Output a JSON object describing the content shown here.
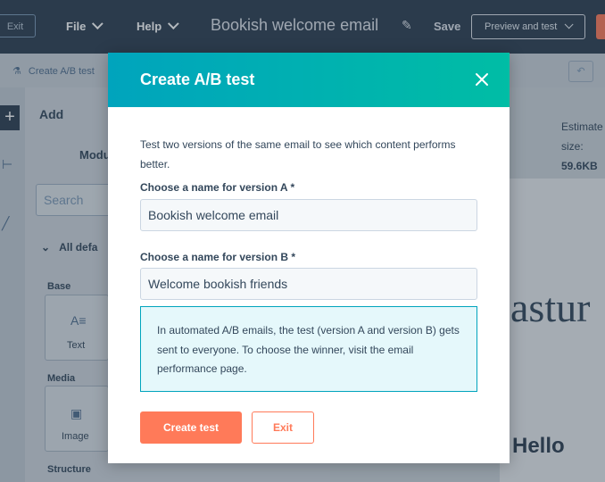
{
  "topbar": {
    "exit_label": "Exit",
    "menu_file": "File",
    "menu_help": "Help",
    "email_title": "Bookish welcome email",
    "save_label": "Save",
    "preview_label": "Preview and test"
  },
  "toolbar": {
    "ab_label": "Create A/B test"
  },
  "sidebar": {
    "add_label": "Add",
    "modules_label": "Modu",
    "search_placeholder": "Search",
    "all_label": "All defa",
    "base_label": "Base",
    "text_tile": "Text",
    "media_label": "Media",
    "image_tile": "Image",
    "structure_label": "Structure"
  },
  "right_panel": {
    "estimated_label": "Estimate",
    "size_label": "size:",
    "size_value": "59.6KB",
    "canvas_text": "astur",
    "hello_text": "Hello"
  },
  "modal": {
    "title": "Create A/B test",
    "description": "Test two versions of the same email to see which content performs better.",
    "label_a": "Choose a name for version A *",
    "value_a": "Bookish welcome email",
    "label_b": "Choose a name for version B *",
    "value_b": "Welcome bookish friends",
    "info": "In automated A/B emails, the test (version A and version B) gets sent to everyone. To choose the winner, visit the email performance page.",
    "create_button": "Create test",
    "exit_button": "Exit"
  },
  "colors": {
    "accent": "#ff7a59",
    "header_start": "#00a4bd",
    "header_end": "#00bda5",
    "topbar": "#2d3e50"
  }
}
